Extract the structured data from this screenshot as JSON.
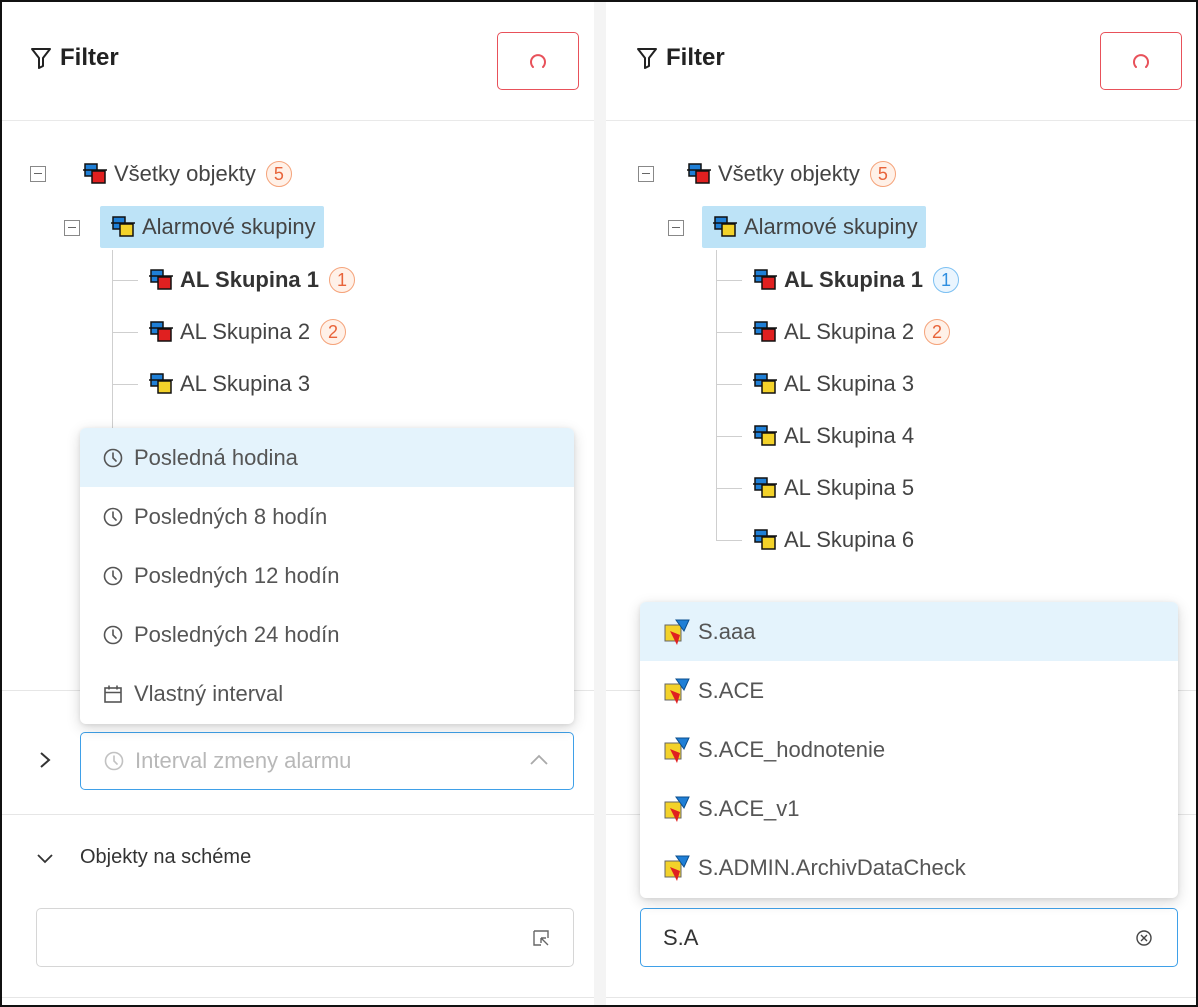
{
  "left_panel": {
    "filter": {
      "title": "Filter",
      "reset_icon": "reset-icon"
    },
    "tree": {
      "root": {
        "label": "Všetky objekty",
        "count": "5",
        "status": "alarm"
      },
      "group": {
        "label": "Alarmové skupiny",
        "status": "normal"
      },
      "children": [
        {
          "label": "AL Skupina 1",
          "count": "1",
          "badge_color": "orange",
          "bold": true,
          "status": "alarm"
        },
        {
          "label": "AL Skupina 2",
          "count": "2",
          "badge_color": "orange",
          "bold": false,
          "status": "alarm"
        },
        {
          "label": "AL Skupina 3",
          "count": "",
          "bold": false,
          "status": "normal"
        }
      ]
    },
    "interval_dropdown": {
      "options": [
        {
          "label": "Posledná hodina",
          "icon": "clock-icon",
          "active": true
        },
        {
          "label": "Posledných 8 hodín",
          "icon": "clock-icon",
          "active": false
        },
        {
          "label": "Posledných 12 hodín",
          "icon": "clock-icon",
          "active": false
        },
        {
          "label": "Posledných 24 hodín",
          "icon": "clock-icon",
          "active": false
        },
        {
          "label": "Vlastný interval",
          "icon": "calendar-icon",
          "active": false
        }
      ]
    },
    "interval_select": {
      "placeholder": "Interval zmeny alarmu",
      "icon": "clock-icon"
    },
    "objects_section": {
      "label": "Objekty na schéme",
      "input_value": ""
    }
  },
  "right_panel": {
    "filter": {
      "title": "Filter",
      "reset_icon": "reset-icon"
    },
    "tree": {
      "root": {
        "label": "Všetky objekty",
        "count": "5",
        "status": "alarm"
      },
      "group": {
        "label": "Alarmové skupiny",
        "status": "normal"
      },
      "children": [
        {
          "label": "AL Skupina 1",
          "count": "1",
          "badge_color": "blue",
          "bold": true,
          "status": "alarm"
        },
        {
          "label": "AL Skupina 2",
          "count": "2",
          "badge_color": "orange",
          "bold": false,
          "status": "alarm"
        },
        {
          "label": "AL Skupina 3",
          "count": "",
          "bold": false,
          "status": "normal"
        },
        {
          "label": "AL Skupina 4",
          "count": "",
          "bold": false,
          "status": "normal"
        },
        {
          "label": "AL Skupina 5",
          "count": "",
          "bold": false,
          "status": "normal"
        },
        {
          "label": "AL Skupina 6",
          "count": "",
          "bold": false,
          "status": "normal"
        }
      ]
    },
    "objects_dropdown": {
      "options": [
        {
          "label": "S.aaa",
          "active": true
        },
        {
          "label": "S.ACE",
          "active": false
        },
        {
          "label": "S.ACE_hodnotenie",
          "active": false
        },
        {
          "label": "S.ACE_v1",
          "active": false
        },
        {
          "label": "S.ADMIN.ArchivDataCheck",
          "active": false
        }
      ]
    },
    "search": {
      "value": "S.A",
      "clear_icon": "clear-icon"
    }
  },
  "colors": {
    "accent": "#3fa0e8",
    "danger": "#e8515a",
    "selection": "#bde3f7",
    "hover": "#e4f3fc",
    "badge_orange": "#e8643a",
    "badge_blue": "#2e8ee0"
  }
}
